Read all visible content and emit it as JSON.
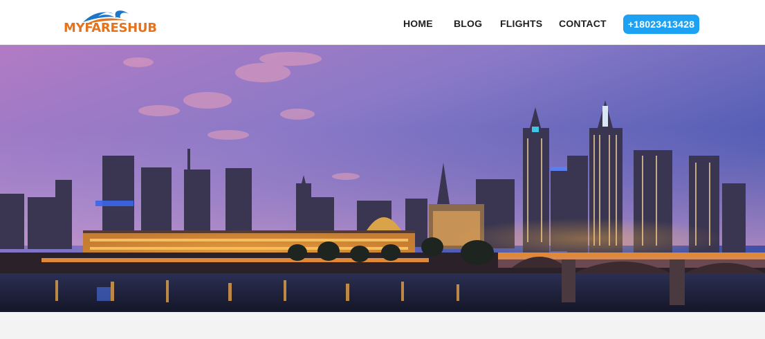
{
  "brand": {
    "name_part1": "MYFARES",
    "name_part2": "HUB",
    "color_primary": "#e4731c",
    "color_secondary": "#1b78c8"
  },
  "nav": {
    "items": [
      {
        "label": "HOME"
      },
      {
        "label": "BLOG"
      },
      {
        "label": "FLIGHTS"
      },
      {
        "label": "CONTACT"
      }
    ],
    "phone_label": "+18023413428",
    "phone_color": "#1da1f2"
  },
  "hero": {
    "icon": "city-skyline-image",
    "sky_top": "#3f4fa0",
    "sky_mid": "#8f6fb8",
    "sky_low": "#e7a9c9"
  }
}
